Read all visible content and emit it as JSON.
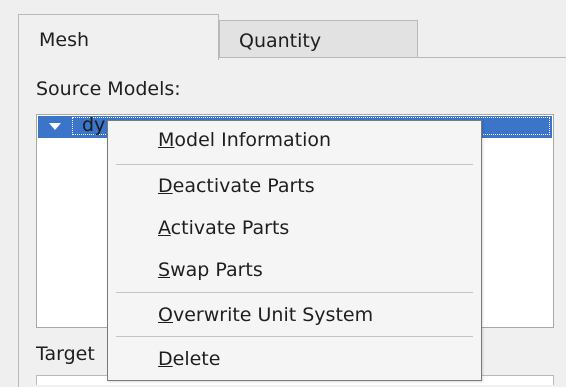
{
  "tabs": [
    {
      "label": "Mesh",
      "active": true
    },
    {
      "label": "Quantity",
      "active": false
    }
  ],
  "source_models": {
    "label": "Source Models:",
    "tree_items": [
      {
        "text": "dy",
        "expanded": true,
        "selected": true
      }
    ]
  },
  "target": {
    "label": "Target"
  },
  "context_menu": {
    "items": [
      {
        "mnemonic": "M",
        "rest": "odel Information"
      },
      {
        "mnemonic": "D",
        "rest": "eactivate Parts"
      },
      {
        "mnemonic": "A",
        "rest": "ctivate Parts"
      },
      {
        "mnemonic": "S",
        "rest": "wap Parts"
      },
      {
        "mnemonic": "O",
        "rest": "verwrite Unit System"
      },
      {
        "mnemonic": "D",
        "rest": "elete"
      }
    ]
  },
  "colors": {
    "selection": "#3a75c9",
    "panel_bg": "#f0f0f0",
    "menu_bg": "#f5f5f5"
  },
  "icons": {
    "tree_expander": "triangle-down-icon"
  }
}
